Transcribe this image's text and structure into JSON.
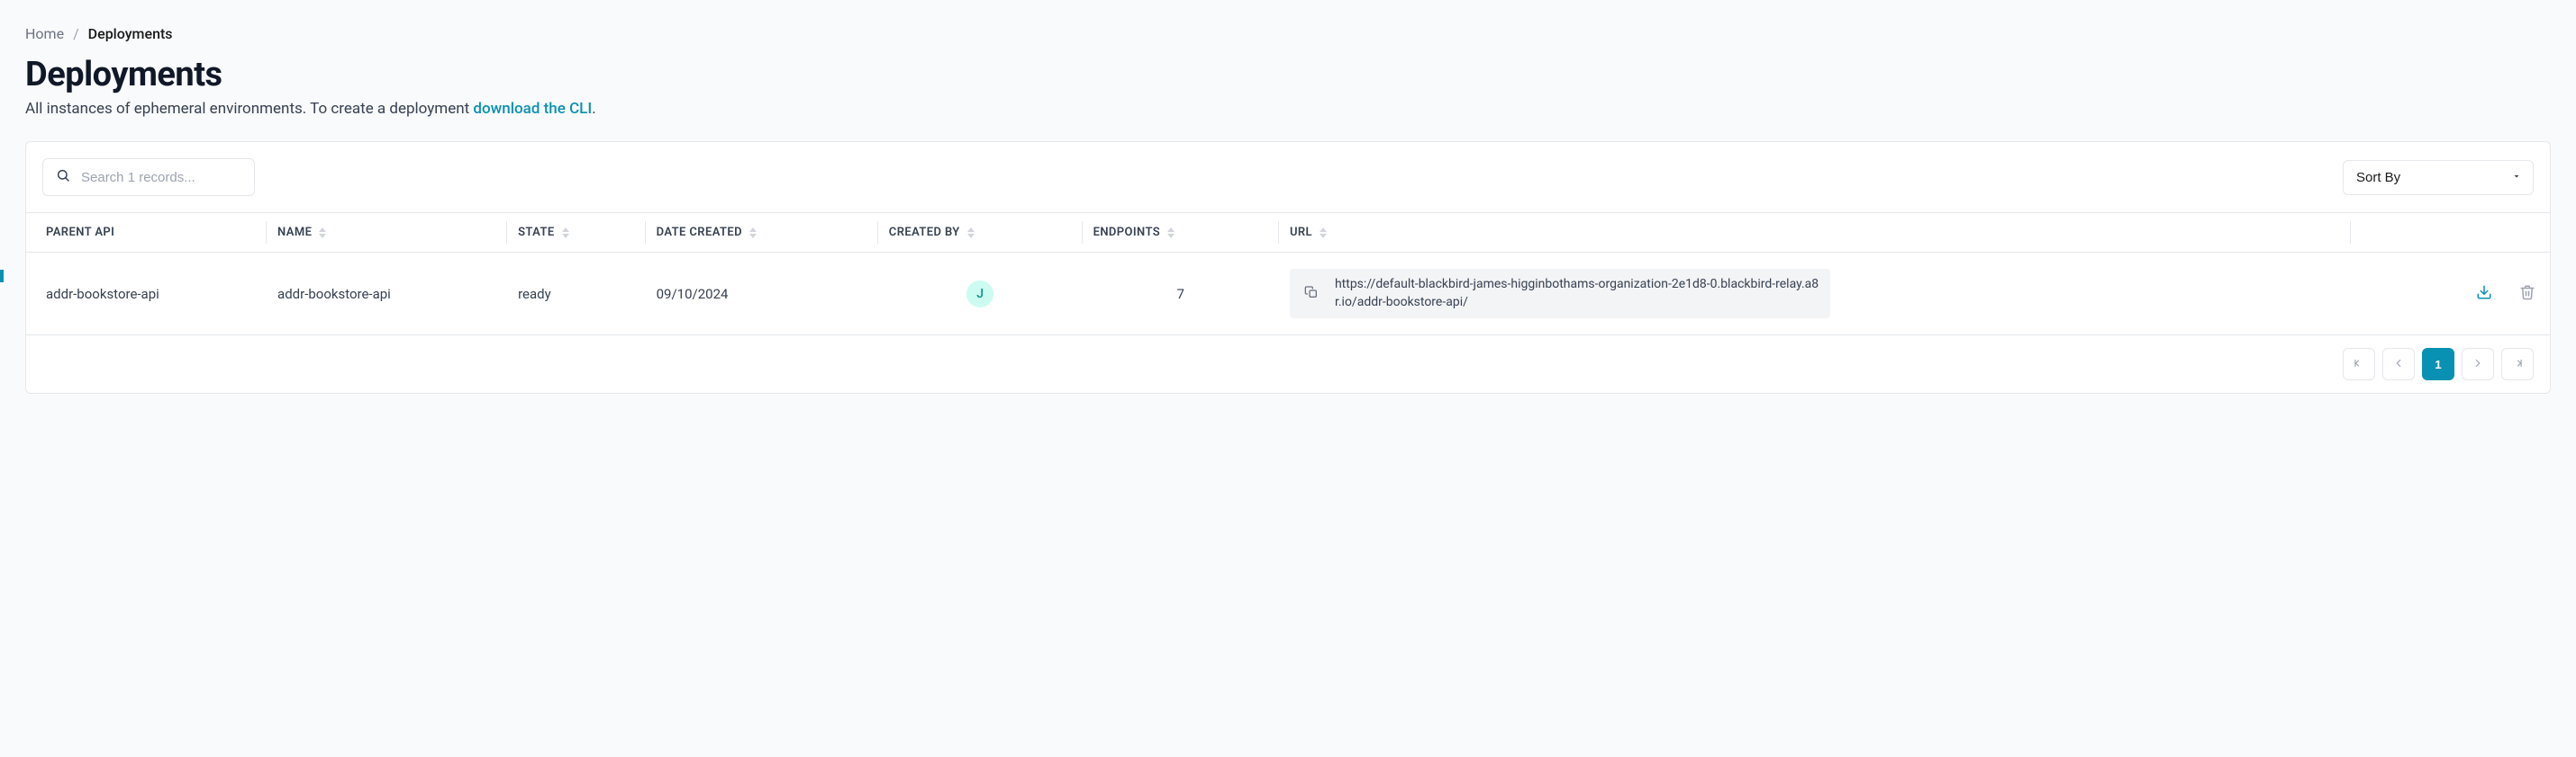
{
  "breadcrumb": {
    "home": "Home",
    "current": "Deployments"
  },
  "header": {
    "title": "Deployments",
    "subtitle_prefix": "All instances of ephemeral environments. To create a deployment ",
    "subtitle_link": "download the CLI",
    "subtitle_suffix": "."
  },
  "toolbar": {
    "search_placeholder": "Search 1 records...",
    "sort_label": "Sort By"
  },
  "table": {
    "columns": {
      "parent_api": "PARENT API",
      "name": "NAME",
      "state": "STATE",
      "date_created": "DATE CREATED",
      "created_by": "CREATED BY",
      "endpoints": "ENDPOINTS",
      "url": "URL"
    },
    "rows": [
      {
        "parent_api": "addr-bookstore-api",
        "name": "addr-bookstore-api",
        "state": "ready",
        "date_created": "09/10/2024",
        "created_by_initial": "J",
        "endpoints": "7",
        "url": "https://default-blackbird-james-higginbothams-organization-2e1d8-0.blackbird-relay.a8r.io/addr-bookstore-api/"
      }
    ]
  },
  "pagination": {
    "current": "1"
  }
}
